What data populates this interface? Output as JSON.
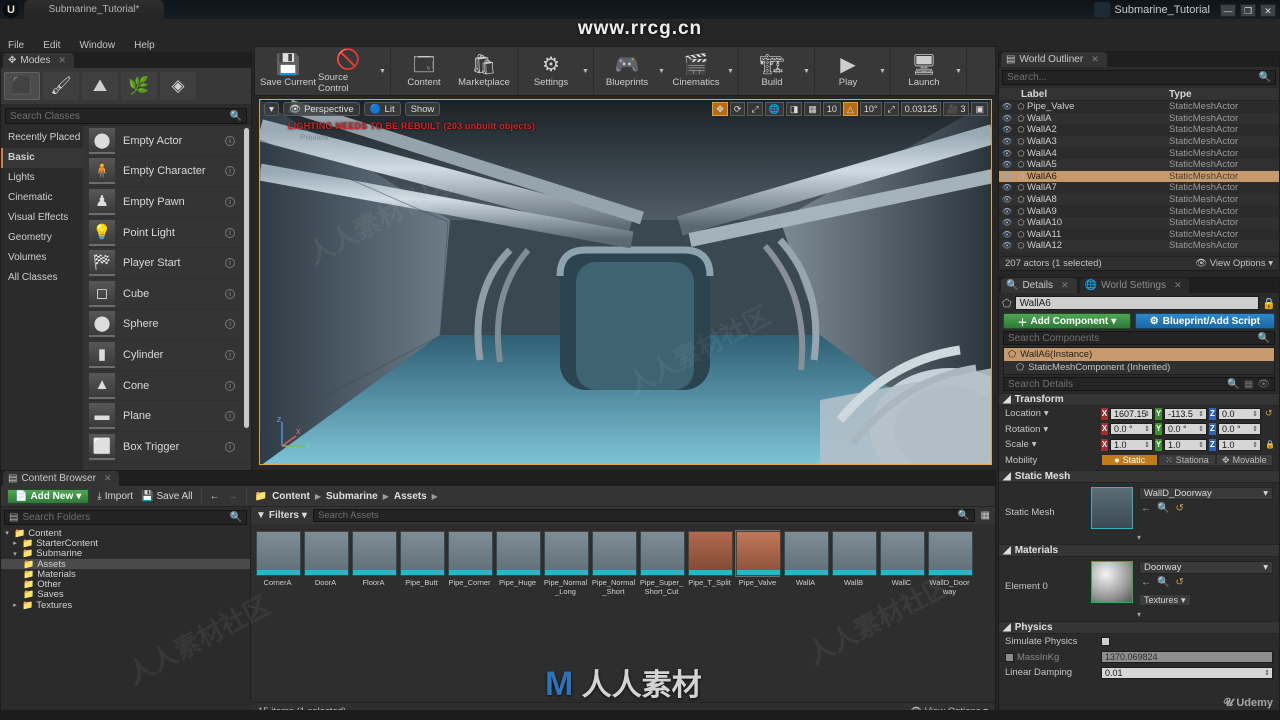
{
  "window": {
    "tab_title": "Submarine_Tutorial*",
    "title": "Submarine_Tutorial",
    "minimize": "—",
    "maximize": "❐",
    "close": "✕"
  },
  "watermarks": {
    "top": "www.rrcg.cn",
    "center_cn": "人人素材",
    "center_m": "M",
    "diagonal": "人人素材社区",
    "udemy": "Udemy"
  },
  "menubar": {
    "items": [
      "File",
      "Edit",
      "Window",
      "Help"
    ]
  },
  "modes": {
    "tab_label": "Modes",
    "icons": [
      {
        "name": "place-mode-icon",
        "glyph": "⬛",
        "selected": true
      },
      {
        "name": "paint-mode-icon",
        "glyph": "🖌",
        "selected": false
      },
      {
        "name": "landscape-mode-icon",
        "glyph": "⛰",
        "selected": false
      },
      {
        "name": "foliage-mode-icon",
        "glyph": "🌿",
        "selected": false
      },
      {
        "name": "geometry-edit-mode-icon",
        "glyph": "◈",
        "selected": false
      }
    ],
    "search_placeholder": "Search Classes",
    "categories": [
      {
        "label": "Recently Placed",
        "selected": false
      },
      {
        "label": "Basic",
        "selected": true
      },
      {
        "label": "Lights",
        "selected": false
      },
      {
        "label": "Cinematic",
        "selected": false
      },
      {
        "label": "Visual Effects",
        "selected": false
      },
      {
        "label": "Geometry",
        "selected": false
      },
      {
        "label": "Volumes",
        "selected": false
      },
      {
        "label": "All Classes",
        "selected": false
      }
    ],
    "placeables": [
      {
        "label": "Empty Actor",
        "glyph": "⬤"
      },
      {
        "label": "Empty Character",
        "glyph": "🧍"
      },
      {
        "label": "Empty Pawn",
        "glyph": "♟"
      },
      {
        "label": "Point Light",
        "glyph": "💡"
      },
      {
        "label": "Player Start",
        "glyph": "🏁"
      },
      {
        "label": "Cube",
        "glyph": "◻"
      },
      {
        "label": "Sphere",
        "glyph": "⬤"
      },
      {
        "label": "Cylinder",
        "glyph": "▮"
      },
      {
        "label": "Cone",
        "glyph": "▲"
      },
      {
        "label": "Plane",
        "glyph": "▬"
      },
      {
        "label": "Box Trigger",
        "glyph": "⬜"
      }
    ]
  },
  "toolbar": {
    "groups": [
      {
        "buttons": [
          {
            "label": "Save Current",
            "icon": "save-icon",
            "glyph": "💾",
            "caret": false
          },
          {
            "label": "Source Control",
            "icon": "source-control-icon",
            "glyph": "🚫",
            "caret": true
          }
        ]
      },
      {
        "buttons": [
          {
            "label": "Content",
            "icon": "content-icon",
            "glyph": "🗔",
            "caret": false
          },
          {
            "label": "Marketplace",
            "icon": "marketplace-icon",
            "glyph": "🛍",
            "caret": false
          }
        ]
      },
      {
        "buttons": [
          {
            "label": "Settings",
            "icon": "settings-icon",
            "glyph": "⚙",
            "caret": true
          }
        ]
      },
      {
        "buttons": [
          {
            "label": "Blueprints",
            "icon": "blueprints-icon",
            "glyph": "🎮",
            "caret": true
          },
          {
            "label": "Cinematics",
            "icon": "cinematics-icon",
            "glyph": "🎬",
            "caret": true
          }
        ]
      },
      {
        "buttons": [
          {
            "label": "Build",
            "icon": "build-icon",
            "glyph": "🏗",
            "caret": true
          }
        ]
      },
      {
        "buttons": [
          {
            "label": "Play",
            "icon": "play-icon",
            "glyph": "▶",
            "caret": true
          }
        ]
      },
      {
        "buttons": [
          {
            "label": "Launch",
            "icon": "launch-icon",
            "glyph": "🖥",
            "caret": true
          }
        ]
      }
    ]
  },
  "viewport": {
    "menu_caret": "▾",
    "camera_mode": "Perspective",
    "view_mode": "Lit",
    "show_menu": "Show",
    "warning": "LIGHTING NEEDS TO BE REBUILT (203 unbuilt objects)",
    "subtext": "Preview",
    "controls": {
      "translate": "✥",
      "rotate": "⟳",
      "scale": "⤢",
      "world": "🌐",
      "surface_snap": "◨",
      "grid_snap": "▦",
      "grid_value": "10",
      "angle_snap": "△",
      "angle_value": "10°",
      "scale_snap": "⤢",
      "scale_value": "0.03125",
      "camera_speed_icon": "🎥",
      "camera_speed": "3",
      "maximize": "▣"
    },
    "axis_labels": {
      "z": "Z",
      "y": "Y",
      "x": "X"
    }
  },
  "outliner": {
    "tab_label": "World Outliner",
    "search_placeholder": "Search...",
    "columns": {
      "label": "Label",
      "type": "Type"
    },
    "sort_glyph": "▲",
    "rows": [
      {
        "name": "Pipe_Valve",
        "type": "StaticMeshActor",
        "selected": false
      },
      {
        "name": "WallA",
        "type": "StaticMeshActor",
        "selected": false
      },
      {
        "name": "WallA2",
        "type": "StaticMeshActor",
        "selected": false
      },
      {
        "name": "WallA3",
        "type": "StaticMeshActor",
        "selected": false
      },
      {
        "name": "WallA4",
        "type": "StaticMeshActor",
        "selected": false
      },
      {
        "name": "WallA5",
        "type": "StaticMeshActor",
        "selected": false
      },
      {
        "name": "WallA6",
        "type": "StaticMeshActor",
        "selected": true
      },
      {
        "name": "WallA7",
        "type": "StaticMeshActor",
        "selected": false
      },
      {
        "name": "WallA8",
        "type": "StaticMeshActor",
        "selected": false
      },
      {
        "name": "WallA9",
        "type": "StaticMeshActor",
        "selected": false
      },
      {
        "name": "WallA10",
        "type": "StaticMeshActor",
        "selected": false
      },
      {
        "name": "WallA11",
        "type": "StaticMeshActor",
        "selected": false
      },
      {
        "name": "WallA12",
        "type": "StaticMeshActor",
        "selected": false
      }
    ],
    "status": "207 actors (1 selected)",
    "view_options": "View Options"
  },
  "details": {
    "tabs": [
      {
        "label": "Details",
        "active": true
      },
      {
        "label": "World Settings",
        "active": false
      }
    ],
    "actor_name": "WallA6",
    "add_component": "Add Component",
    "blueprint_button": "Blueprint/Add Script",
    "search_components_placeholder": "Search Components",
    "components": [
      {
        "label": "WallA6(Instance)",
        "selected": true
      },
      {
        "label": "StaticMeshComponent (Inherited)",
        "selected": false
      }
    ],
    "search_details_placeholder": "Search Details",
    "sections": {
      "transform": {
        "title": "Transform",
        "location": {
          "label": "Location",
          "x": "1607.15",
          "y": "-113.5",
          "z": "0.0"
        },
        "rotation": {
          "label": "Rotation",
          "x": "0.0 °",
          "y": "0.0 °",
          "z": "0.0 °"
        },
        "scale": {
          "label": "Scale",
          "x": "1.0",
          "y": "1.0",
          "z": "1.0"
        },
        "mobility": {
          "label": "Mobility",
          "options": [
            {
              "label": "Static",
              "selected": true
            },
            {
              "label": "Stationa",
              "selected": false
            },
            {
              "label": "Movable",
              "selected": false
            }
          ]
        }
      },
      "static_mesh": {
        "title": "Static Mesh",
        "label": "Static Mesh",
        "value": "WallD_Doorway"
      },
      "materials": {
        "title": "Materials",
        "label": "Element 0",
        "value": "Doorway",
        "textures_button": "Textures"
      },
      "physics": {
        "title": "Physics",
        "simulate_physics": "Simulate Physics",
        "mass_label": "MassInKg",
        "mass_value": "1370.069824",
        "linear_damping_label": "Linear Damping",
        "linear_damping_value": "0.01"
      }
    }
  },
  "content_browser": {
    "tab_label": "Content Browser",
    "add_new": "Add New",
    "import": "Import",
    "save_all": "Save All",
    "back_arrow": "←",
    "forward_arrow": "→",
    "breadcrumb": [
      "Content",
      "Submarine",
      "Assets"
    ],
    "folder_search_placeholder": "Search Folders",
    "filters_label": "Filters",
    "asset_search_placeholder": "Search Assets",
    "tree": [
      {
        "label": "Content",
        "depth": 0,
        "twisty": "▾",
        "selected": false
      },
      {
        "label": "StarterContent",
        "depth": 1,
        "twisty": "▸",
        "selected": false
      },
      {
        "label": "Submarine",
        "depth": 1,
        "twisty": "▾",
        "selected": false
      },
      {
        "label": "Assets",
        "depth": 2,
        "twisty": "",
        "selected": true
      },
      {
        "label": "Materials",
        "depth": 2,
        "twisty": "",
        "selected": false
      },
      {
        "label": "Other",
        "depth": 2,
        "twisty": "",
        "selected": false
      },
      {
        "label": "Saves",
        "depth": 2,
        "twisty": "",
        "selected": false
      },
      {
        "label": "Textures",
        "depth": 1,
        "twisty": "▸",
        "selected": false
      }
    ],
    "assets": [
      {
        "label": "CornerA",
        "selected": false
      },
      {
        "label": "DoorA",
        "selected": false
      },
      {
        "label": "FloorA",
        "selected": false
      },
      {
        "label": "Pipe_Butt",
        "selected": false
      },
      {
        "label": "Pipe_Corner",
        "selected": false
      },
      {
        "label": "Pipe_Huge",
        "selected": false
      },
      {
        "label": "Pipe_Normal_Long",
        "selected": false
      },
      {
        "label": "Pipe_Normal_Short",
        "selected": false
      },
      {
        "label": "Pipe_Super_Short_Cut",
        "selected": false
      },
      {
        "label": "Pipe_T_Split",
        "selected": false
      },
      {
        "label": "Pipe_Valve",
        "selected": true
      },
      {
        "label": "WallA",
        "selected": false
      },
      {
        "label": "WallB",
        "selected": false
      },
      {
        "label": "WallC",
        "selected": false
      },
      {
        "label": "WallD_Doorway",
        "selected": false
      }
    ],
    "status": "15 items (1 selected)",
    "view_options": "View Options"
  },
  "colors": {
    "accent_orange": "#e3a33a",
    "selection": "#c79a6d",
    "green_button": "#3e8f45",
    "blue_button": "#2578b8",
    "warning_red": "#cf2525"
  }
}
